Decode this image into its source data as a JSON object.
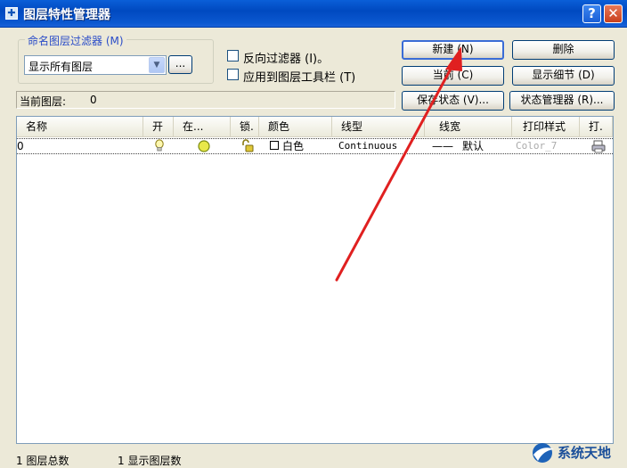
{
  "window": {
    "title": "图层特性管理器",
    "help_label": "?",
    "close_label": "✕"
  },
  "filter": {
    "group_title": "命名图层过滤器 (M)",
    "selected": "显示所有图层",
    "browse_label": "...",
    "invert_label": "反向过滤器 (I)。",
    "apply_toolbar_label": "应用到图层工具栏 (T)"
  },
  "buttons": {
    "new": "新建 (N)",
    "delete": "删除",
    "current": "当前 (C)",
    "show_details": "显示细节 (D)",
    "save_state": "保存状态 (V)...",
    "state_manager": "状态管理器 (R)..."
  },
  "current_layer": {
    "label": "当前图层:",
    "value": "0"
  },
  "table": {
    "columns": [
      "名称",
      "开",
      "在...",
      "锁.",
      "颜色",
      "线型",
      "线宽",
      "打印样式",
      "打."
    ],
    "rows": [
      {
        "name": "0",
        "color_name": "白色",
        "linetype": "Continuous",
        "lineweight_line": "——",
        "lineweight": "默认",
        "plot_style": "Color_7"
      }
    ]
  },
  "status": {
    "total": "1  图层总数",
    "shown": "1  显示图层数"
  },
  "watermark": {
    "text": "系统天地"
  },
  "colors": {
    "title_bar": "#0a5fd8",
    "arrow": "#e02020",
    "accent_text": "#2a4cc8"
  }
}
